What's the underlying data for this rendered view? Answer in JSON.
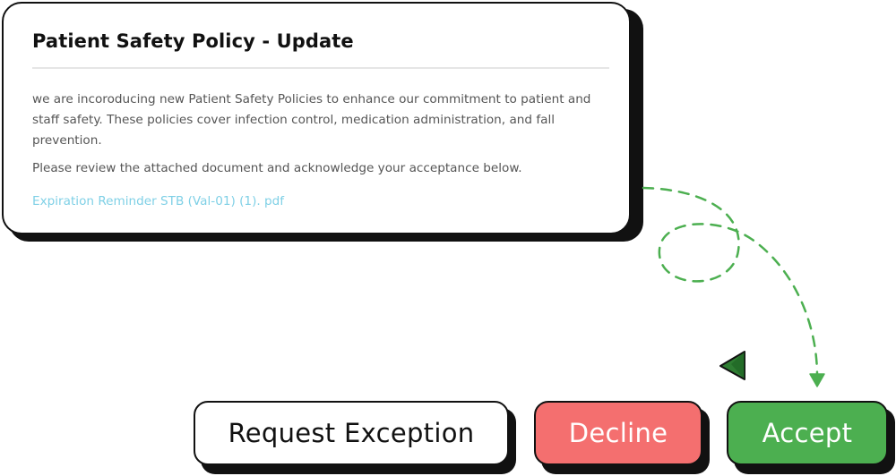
{
  "notice": {
    "title": "Patient Safety Policy - Update",
    "body": "we are incoroducing new Patient Safety Policies to enhance our commitment to patient and staff safety. These policies cover infection control, medication administration, and fall prevention.",
    "instruction": "Please review the attached document and acknowledge your acceptance below.",
    "attachment": "Expiration Reminder STB (Val-01) (1). pdf"
  },
  "actions": {
    "request_exception": "Request Exception",
    "decline": "Decline",
    "accept": "Accept"
  },
  "colors": {
    "accept": "#4caf50",
    "decline": "#f46f6f",
    "link": "#7fd0e6",
    "connector": "#4caf50"
  },
  "icons": {
    "connector": "dashed-arrow-icon",
    "pointer": "cursor-pointer-icon"
  }
}
